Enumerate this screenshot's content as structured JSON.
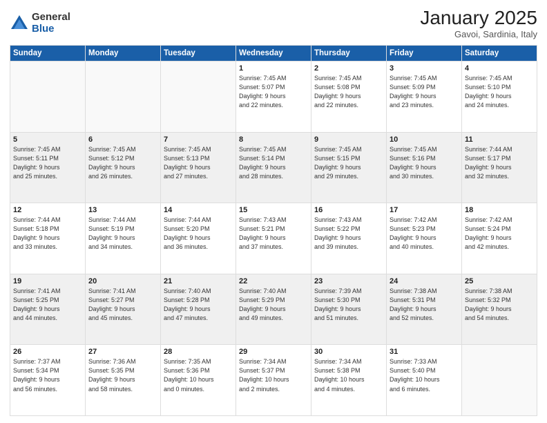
{
  "logo": {
    "general": "General",
    "blue": "Blue"
  },
  "header": {
    "month": "January 2025",
    "location": "Gavoi, Sardinia, Italy"
  },
  "weekdays": [
    "Sunday",
    "Monday",
    "Tuesday",
    "Wednesday",
    "Thursday",
    "Friday",
    "Saturday"
  ],
  "weeks": [
    [
      {
        "day": "",
        "info": ""
      },
      {
        "day": "",
        "info": ""
      },
      {
        "day": "",
        "info": ""
      },
      {
        "day": "1",
        "info": "Sunrise: 7:45 AM\nSunset: 5:07 PM\nDaylight: 9 hours\nand 22 minutes."
      },
      {
        "day": "2",
        "info": "Sunrise: 7:45 AM\nSunset: 5:08 PM\nDaylight: 9 hours\nand 22 minutes."
      },
      {
        "day": "3",
        "info": "Sunrise: 7:45 AM\nSunset: 5:09 PM\nDaylight: 9 hours\nand 23 minutes."
      },
      {
        "day": "4",
        "info": "Sunrise: 7:45 AM\nSunset: 5:10 PM\nDaylight: 9 hours\nand 24 minutes."
      }
    ],
    [
      {
        "day": "5",
        "info": "Sunrise: 7:45 AM\nSunset: 5:11 PM\nDaylight: 9 hours\nand 25 minutes."
      },
      {
        "day": "6",
        "info": "Sunrise: 7:45 AM\nSunset: 5:12 PM\nDaylight: 9 hours\nand 26 minutes."
      },
      {
        "day": "7",
        "info": "Sunrise: 7:45 AM\nSunset: 5:13 PM\nDaylight: 9 hours\nand 27 minutes."
      },
      {
        "day": "8",
        "info": "Sunrise: 7:45 AM\nSunset: 5:14 PM\nDaylight: 9 hours\nand 28 minutes."
      },
      {
        "day": "9",
        "info": "Sunrise: 7:45 AM\nSunset: 5:15 PM\nDaylight: 9 hours\nand 29 minutes."
      },
      {
        "day": "10",
        "info": "Sunrise: 7:45 AM\nSunset: 5:16 PM\nDaylight: 9 hours\nand 30 minutes."
      },
      {
        "day": "11",
        "info": "Sunrise: 7:44 AM\nSunset: 5:17 PM\nDaylight: 9 hours\nand 32 minutes."
      }
    ],
    [
      {
        "day": "12",
        "info": "Sunrise: 7:44 AM\nSunset: 5:18 PM\nDaylight: 9 hours\nand 33 minutes."
      },
      {
        "day": "13",
        "info": "Sunrise: 7:44 AM\nSunset: 5:19 PM\nDaylight: 9 hours\nand 34 minutes."
      },
      {
        "day": "14",
        "info": "Sunrise: 7:44 AM\nSunset: 5:20 PM\nDaylight: 9 hours\nand 36 minutes."
      },
      {
        "day": "15",
        "info": "Sunrise: 7:43 AM\nSunset: 5:21 PM\nDaylight: 9 hours\nand 37 minutes."
      },
      {
        "day": "16",
        "info": "Sunrise: 7:43 AM\nSunset: 5:22 PM\nDaylight: 9 hours\nand 39 minutes."
      },
      {
        "day": "17",
        "info": "Sunrise: 7:42 AM\nSunset: 5:23 PM\nDaylight: 9 hours\nand 40 minutes."
      },
      {
        "day": "18",
        "info": "Sunrise: 7:42 AM\nSunset: 5:24 PM\nDaylight: 9 hours\nand 42 minutes."
      }
    ],
    [
      {
        "day": "19",
        "info": "Sunrise: 7:41 AM\nSunset: 5:25 PM\nDaylight: 9 hours\nand 44 minutes."
      },
      {
        "day": "20",
        "info": "Sunrise: 7:41 AM\nSunset: 5:27 PM\nDaylight: 9 hours\nand 45 minutes."
      },
      {
        "day": "21",
        "info": "Sunrise: 7:40 AM\nSunset: 5:28 PM\nDaylight: 9 hours\nand 47 minutes."
      },
      {
        "day": "22",
        "info": "Sunrise: 7:40 AM\nSunset: 5:29 PM\nDaylight: 9 hours\nand 49 minutes."
      },
      {
        "day": "23",
        "info": "Sunrise: 7:39 AM\nSunset: 5:30 PM\nDaylight: 9 hours\nand 51 minutes."
      },
      {
        "day": "24",
        "info": "Sunrise: 7:38 AM\nSunset: 5:31 PM\nDaylight: 9 hours\nand 52 minutes."
      },
      {
        "day": "25",
        "info": "Sunrise: 7:38 AM\nSunset: 5:32 PM\nDaylight: 9 hours\nand 54 minutes."
      }
    ],
    [
      {
        "day": "26",
        "info": "Sunrise: 7:37 AM\nSunset: 5:34 PM\nDaylight: 9 hours\nand 56 minutes."
      },
      {
        "day": "27",
        "info": "Sunrise: 7:36 AM\nSunset: 5:35 PM\nDaylight: 9 hours\nand 58 minutes."
      },
      {
        "day": "28",
        "info": "Sunrise: 7:35 AM\nSunset: 5:36 PM\nDaylight: 10 hours\nand 0 minutes."
      },
      {
        "day": "29",
        "info": "Sunrise: 7:34 AM\nSunset: 5:37 PM\nDaylight: 10 hours\nand 2 minutes."
      },
      {
        "day": "30",
        "info": "Sunrise: 7:34 AM\nSunset: 5:38 PM\nDaylight: 10 hours\nand 4 minutes."
      },
      {
        "day": "31",
        "info": "Sunrise: 7:33 AM\nSunset: 5:40 PM\nDaylight: 10 hours\nand 6 minutes."
      },
      {
        "day": "",
        "info": ""
      }
    ]
  ]
}
